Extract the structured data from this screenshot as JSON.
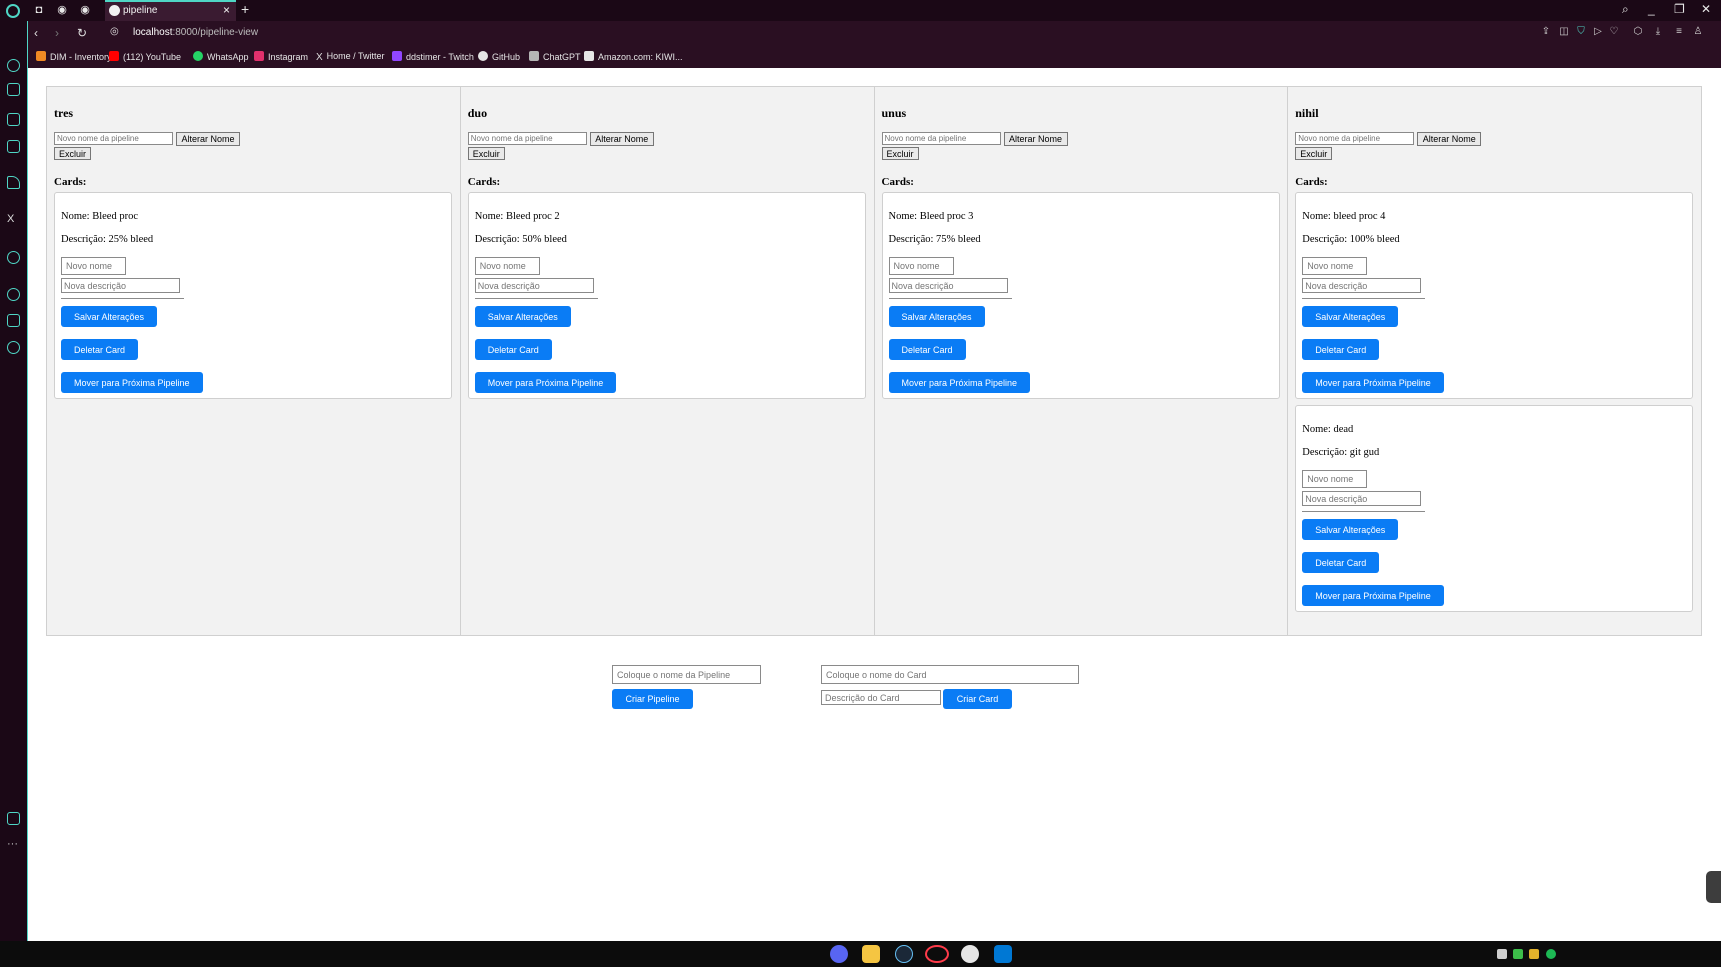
{
  "browser": {
    "tab_title": "pipeline",
    "url_host": "localhost",
    "url_path": ":8000/pipeline-view",
    "bookmarks": [
      "DIM - Inventory",
      "(112) YouTube",
      "WhatsApp",
      "Instagram",
      "Home / Twitter",
      "ddstimer - Twitch",
      "GitHub",
      "ChatGPT",
      "Amazon.com: KIWI..."
    ]
  },
  "labels": {
    "rename_placeholder": "Novo nome da pipeline",
    "rename_button": "Alterar Nome",
    "delete_pipeline_button": "Excluir",
    "cards_heading": "Cards:",
    "name_prefix": "Nome: ",
    "desc_prefix": "Descrição: ",
    "card_name_placeholder": "Novo nome",
    "card_desc_placeholder": "Nova descrição",
    "save_button": "Salvar Alterações",
    "delete_card_button": "Deletar Card",
    "move_button": "Mover para Próxima Pipeline"
  },
  "pipelines": [
    {
      "name": "tres",
      "cards": [
        {
          "name": "Bleed proc",
          "description": "25% bleed"
        }
      ]
    },
    {
      "name": "duo",
      "cards": [
        {
          "name": "Bleed proc 2",
          "description": "50% bleed"
        }
      ]
    },
    {
      "name": "unus",
      "cards": [
        {
          "name": "Bleed proc 3",
          "description": "75% bleed"
        }
      ]
    },
    {
      "name": "nihil",
      "cards": [
        {
          "name": "bleed proc 4",
          "description": "100% bleed"
        },
        {
          "name": "dead",
          "description": "git gud"
        }
      ]
    }
  ],
  "create": {
    "pipeline_placeholder": "Coloque o nome da Pipeline",
    "pipeline_button": "Criar Pipeline",
    "card_name_placeholder": "Coloque o nome do Card",
    "card_desc_placeholder": "Descrição do Card",
    "card_button": "Criar Card"
  },
  "colors": {
    "primary_button": "#0a7cf5",
    "browser_accent": "#4fd6c5"
  }
}
